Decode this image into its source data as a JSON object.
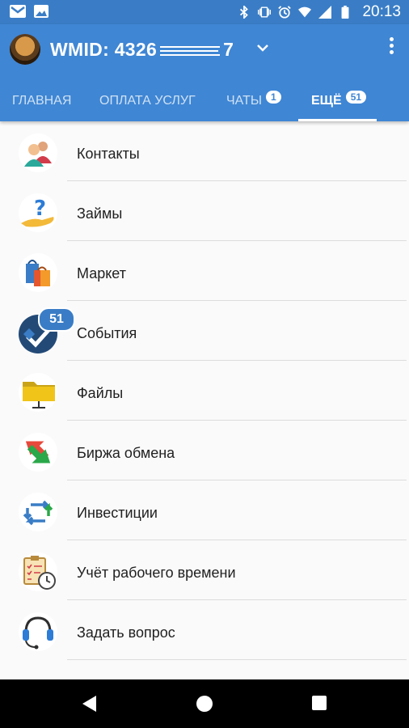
{
  "status_bar": {
    "time": "20:13",
    "left_icons": [
      "gmail-icon",
      "image-icon"
    ],
    "right_icons": [
      "bluetooth-icon",
      "vibrate-icon",
      "alarm-icon",
      "wifi-icon",
      "signal-icon",
      "battery-icon"
    ]
  },
  "header": {
    "wmid": "WMID: 4326",
    "wmid_suffix": "7",
    "chevron": "chevron-down-icon"
  },
  "tabs": [
    {
      "label": "ГЛАВНАЯ",
      "badge": ""
    },
    {
      "label": "ОПЛАТА УСЛУГ",
      "badge": ""
    },
    {
      "label": "ЧАТЫ",
      "badge": "1"
    },
    {
      "label": "ЕЩЁ",
      "badge": "51"
    }
  ],
  "menu": [
    {
      "label": "Контакты",
      "icon": "contacts-icon",
      "badge": ""
    },
    {
      "label": "Займы",
      "icon": "loans-icon",
      "badge": ""
    },
    {
      "label": "Маркет",
      "icon": "market-icon",
      "badge": ""
    },
    {
      "label": "События",
      "icon": "events-icon",
      "badge": "51"
    },
    {
      "label": "Файлы",
      "icon": "files-icon",
      "badge": ""
    },
    {
      "label": "Биржа обмена",
      "icon": "exchange-icon",
      "badge": ""
    },
    {
      "label": "Инвестиции",
      "icon": "investments-icon",
      "badge": ""
    },
    {
      "label": "Учёт рабочего времени",
      "icon": "time-tracking-icon",
      "badge": ""
    },
    {
      "label": "Задать вопрос",
      "icon": "support-headset-icon",
      "badge": ""
    }
  ],
  "colors": {
    "status_bar": "#3a7dc6",
    "app_bar": "#3f86d4",
    "background": "#fafafa"
  }
}
